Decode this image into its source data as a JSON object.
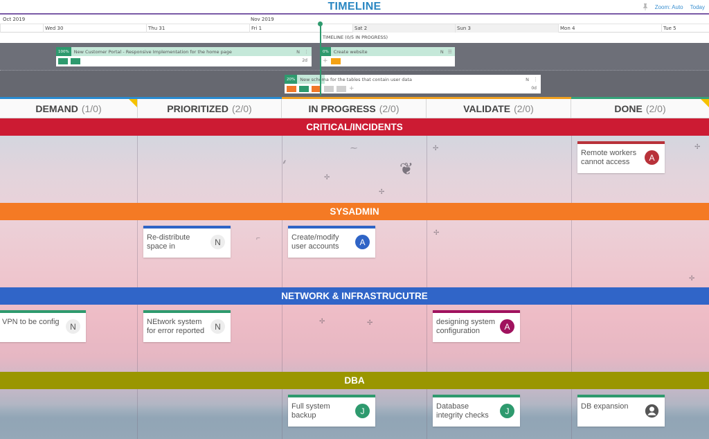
{
  "timeline": {
    "title": "TIMELINE",
    "zoom_label": "Zoom: Auto",
    "today_label": "Today",
    "pin_icon": "pushpin-icon",
    "months": [
      {
        "label": "Oct 2019"
      },
      {
        "label": "Nov 2019"
      }
    ],
    "days": [
      {
        "label": "Wed 30"
      },
      {
        "label": "Thu 31"
      },
      {
        "label": "Fri 1"
      },
      {
        "label": "Sat 2"
      },
      {
        "label": "Sun 3"
      },
      {
        "label": "Mon 4"
      },
      {
        "label": "Tue 5"
      }
    ],
    "status": "TIMELINE (0/5 IN PROGRESS)",
    "tasks": [
      {
        "percent": "100%",
        "name": "New Customer Portal - Responsive Implementation for the home page",
        "assignee": "N",
        "duration": "2d",
        "chips": [
          "green",
          "green"
        ]
      },
      {
        "percent": "0%",
        "name": "Create website",
        "assignee": "N",
        "duration": "",
        "chips": [
          "amber"
        ]
      },
      {
        "percent": "20%",
        "name": "New schema for the tables that contain user data",
        "assignee": "N",
        "duration": "0d",
        "chips": [
          "orange",
          "green",
          "orange",
          "grey",
          "grey"
        ]
      }
    ]
  },
  "columns": [
    {
      "label": "DEMAND",
      "count": "(1/0)",
      "top_color": "#2a8bd0"
    },
    {
      "label": "PRIORITIZED",
      "count": "(2/0)",
      "top_color": "#2a8bd0"
    },
    {
      "label": "IN PROGRESS",
      "count": "(2/0)",
      "top_color": "#f0a020"
    },
    {
      "label": "VALIDATE",
      "count": "(2/0)",
      "top_color": "#f0a020"
    },
    {
      "label": "DONE",
      "count": "(2/0)",
      "top_color": "#35a27a"
    }
  ],
  "lanes": [
    {
      "label": "CRITICAL/INCIDENTS",
      "color": "#cc1b33"
    },
    {
      "label": "SYSADMIN",
      "color": "#f47a24"
    },
    {
      "label": "NETWORK & INFRASTRUCUTRE",
      "color": "#3065c8"
    },
    {
      "label": "DBA",
      "color": "#9a9600"
    }
  ],
  "cards": [
    {
      "text": "Remote workers cannot access",
      "lane": "CRITICAL/INCIDENTS",
      "column": "DONE",
      "avatar": "A",
      "bar_color": "#b8323a",
      "avatar_color": "#b8323a"
    },
    {
      "text": "Re-distribute space in",
      "lane": "SYSADMIN",
      "column": "PRIORITIZED",
      "avatar": "N",
      "bar_color": "#2f64c6",
      "avatar_color": "#ededed"
    },
    {
      "text": "Create/modify user accounts",
      "lane": "SYSADMIN",
      "column": "IN PROGRESS",
      "avatar": "A",
      "bar_color": "#2f64c6",
      "avatar_color": "#2f64c6"
    },
    {
      "text": "VPN to be config",
      "lane": "NETWORK & INFRASTRUCUTRE",
      "column": "DEMAND",
      "avatar": "N",
      "bar_color": "#2e9a6e",
      "avatar_color": "#ededed"
    },
    {
      "text": "NEtwork system for error reported",
      "lane": "NETWORK & INFRASTRUCUTRE",
      "column": "PRIORITIZED",
      "avatar": "N",
      "bar_color": "#2e9a6e",
      "avatar_color": "#ededed"
    },
    {
      "text": "designing system configuration",
      "lane": "NETWORK & INFRASTRUCUTRE",
      "column": "VALIDATE",
      "avatar": "A",
      "bar_color": "#a0125e",
      "avatar_color": "#a0125e"
    },
    {
      "text": "Full system backup",
      "lane": "DBA",
      "column": "IN PROGRESS",
      "avatar": "J",
      "bar_color": "#2e9a6e",
      "avatar_color": "#2e9a6e"
    },
    {
      "text": "Database integrity checks",
      "lane": "DBA",
      "column": "VALIDATE",
      "avatar": "J",
      "bar_color": "#2e9a6e",
      "avatar_color": "#2e9a6e"
    },
    {
      "text": "DB expansion",
      "lane": "DBA",
      "column": "DONE",
      "avatar": "user-icon",
      "bar_color": "#2e9a6e",
      "avatar_color": "#555555"
    }
  ]
}
